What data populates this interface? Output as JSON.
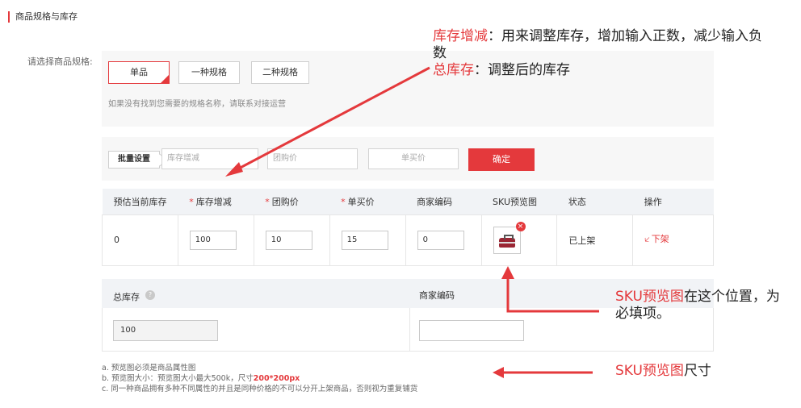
{
  "section": {
    "title": "商品规格与库存"
  },
  "spec": {
    "label": "请选择商品规格:",
    "options": [
      "单品",
      "一种规格",
      "二种规格"
    ],
    "selected": "单品",
    "hint": "如果没有找到您需要的规格名称，请联系对接运营"
  },
  "batch": {
    "label": "批量设置",
    "stock_change_placeholder": "库存增减",
    "group_price_placeholder": "团购价",
    "single_price_placeholder": "单买价",
    "confirm": "确定"
  },
  "table": {
    "headers": [
      "预估当前库存",
      "库存增减",
      "团购价",
      "单买价",
      "商家编码",
      "SKU预览图",
      "状态",
      "操作"
    ],
    "required_mark": "*",
    "row": {
      "estimated_stock": "0",
      "stock_change": "100",
      "group_price": "10",
      "single_price": "15",
      "merchant_code": "0",
      "status": "已上架",
      "action": "下架",
      "remove": "×"
    }
  },
  "total": {
    "label": "总库存",
    "help": "?",
    "value": "100",
    "code_label": "商家编码",
    "code_value": ""
  },
  "notes": {
    "line_a": "a. 预览图必须是商品属性图",
    "line_b_prefix": "b. 预览图大小：预览图大小最大500k，尺寸",
    "line_b_size": "200*200px",
    "line_c": "c. 同一种商品拥有多种不同属性的并且是同种价格的不可以分开上架商品，否则视为重复铺货"
  },
  "annotations": {
    "a1_red": "库存增减",
    "a1_text": "：用来调整库存，增加输入正数，减少输入负数",
    "a1b_red": "总库存",
    "a1b_text": "：调整后的库存",
    "a2_red": "SKU预览图",
    "a2_text": "在这个位置，为必填项。",
    "a3_red": "SKU预览图",
    "a3_text": "尺寸"
  },
  "colors": {
    "accent": "#e4393c",
    "annotation": "#e4393c"
  }
}
